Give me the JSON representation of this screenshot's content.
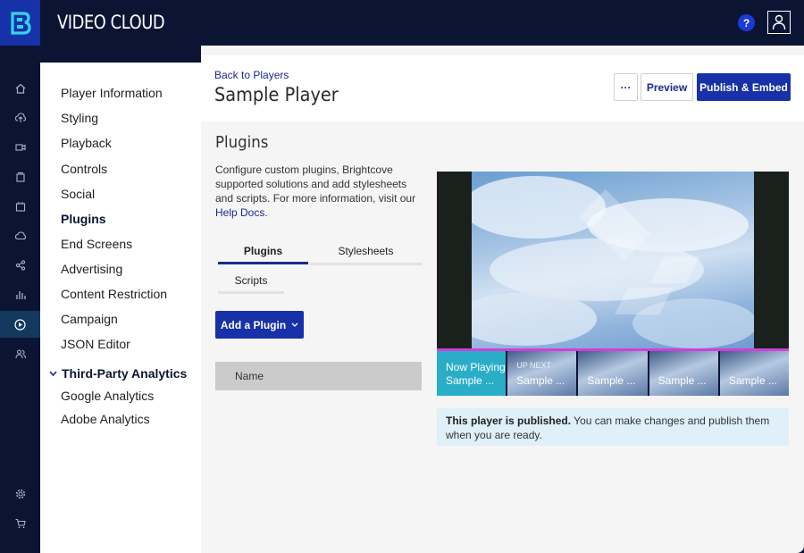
{
  "topbar": {
    "brand": "VIDEO CLOUD",
    "help_label": "?"
  },
  "rail": {
    "icons": [
      "home-icon",
      "upload-icon",
      "media-icon",
      "gallery-icon",
      "live-icon",
      "cloud-icon",
      "social-icon",
      "analytics-icon",
      "players-icon",
      "users-icon",
      "settings-icon",
      "cart-icon"
    ],
    "active": "players-icon"
  },
  "nav": {
    "items": [
      "Player Information",
      "Styling",
      "Playback",
      "Controls",
      "Social",
      "Plugins",
      "End Screens",
      "Advertising",
      "Content Restriction",
      "Campaign",
      "JSON Editor"
    ],
    "active_index": 5,
    "third_party": {
      "header": "Third-Party Analytics",
      "items": [
        "Google Analytics",
        "Adobe Analytics"
      ]
    }
  },
  "header": {
    "back_link": "Back to Players",
    "title": "Sample Player",
    "more_label": "···",
    "preview_label": "Preview",
    "publish_label": "Publish & Embed"
  },
  "plugins": {
    "title": "Plugins",
    "description": "Configure custom plugins, Brightcove supported solutions and add stylesheets and scripts. For more information, visit our",
    "help_link": "Help Docs.",
    "tabs": [
      "Plugins",
      "Stylesheets",
      "Scripts"
    ],
    "active_tab": "Plugins",
    "add_button": "Add a Plugin",
    "table_header": "Name"
  },
  "player_preview": {
    "playlist": [
      {
        "status": "Now Playing",
        "title": "Sample ..."
      },
      {
        "status": "UP NEXT",
        "title": "Sample ..."
      },
      {
        "status": "",
        "title": "Sample ..."
      },
      {
        "status": "",
        "title": "Sample ..."
      },
      {
        "status": "",
        "title": "Sample ..."
      }
    ],
    "progress_color": "#d23fd9"
  },
  "notice": {
    "bold": "This player is published.",
    "text": " You can make changes and publish them when you are ready."
  },
  "colors": {
    "navy": "#0b1533",
    "accent": "#1731a8",
    "link": "#1a2b8c"
  }
}
